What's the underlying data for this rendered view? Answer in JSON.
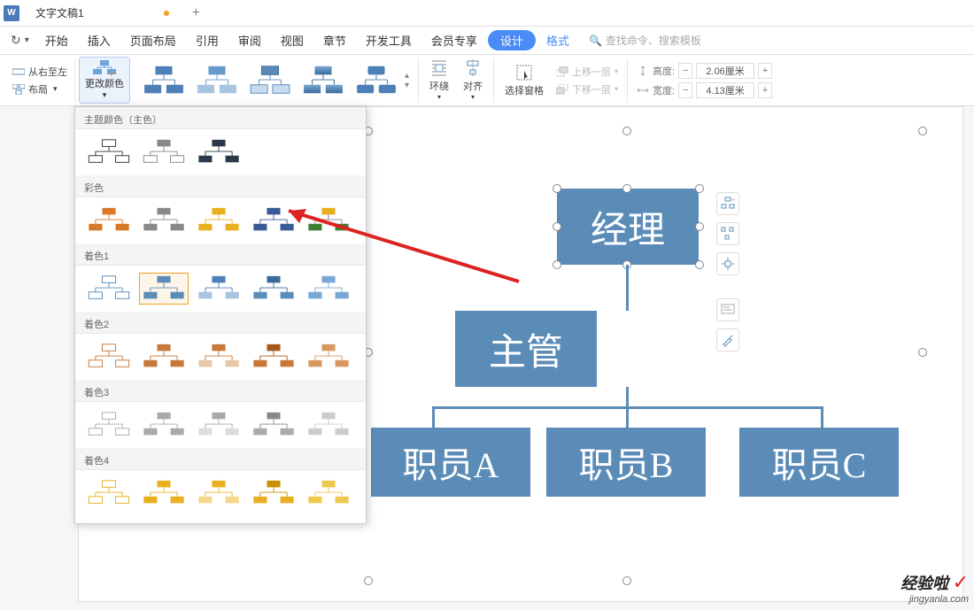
{
  "title_bar": {
    "doc_label": "W",
    "doc_name": "文字文稿1"
  },
  "menu": {
    "redo": "↻",
    "dropdown_glyph": "▾",
    "items": [
      "开始",
      "插入",
      "页面布局",
      "引用",
      "审阅",
      "视图",
      "章节",
      "开发工具",
      "会员专享"
    ],
    "design": "设计",
    "format": "格式",
    "search_placeholder": "查找命令、搜索模板",
    "search_glyph": "🔍"
  },
  "ribbon": {
    "rtl": "从右至左",
    "layout": "布局",
    "change_color": "更改颜色",
    "wrap": "环绕",
    "align": "对齐",
    "select_pane": "选择窗格",
    "up_layer": "上移一层",
    "down_layer": "下移一层",
    "height_lbl": "高度:",
    "width_lbl": "宽度:",
    "height_val": "2.06厘米",
    "width_val": "4.13厘米",
    "minus": "−",
    "plus": "+"
  },
  "dropdown": {
    "s_theme": "主题颜色（主色）",
    "s_colorful": "彩色",
    "s_a1": "着色1",
    "s_a2": "着色2",
    "s_a3": "着色3",
    "s_a4": "着色4"
  },
  "chart_boxes": {
    "manager": "经理",
    "supervisor": "主管",
    "empA": "职员A",
    "empB": "职员B",
    "empC": "职员C"
  },
  "watermark": {
    "main": "经验啦",
    "check": "✓",
    "sub": "jingyanla.com"
  }
}
